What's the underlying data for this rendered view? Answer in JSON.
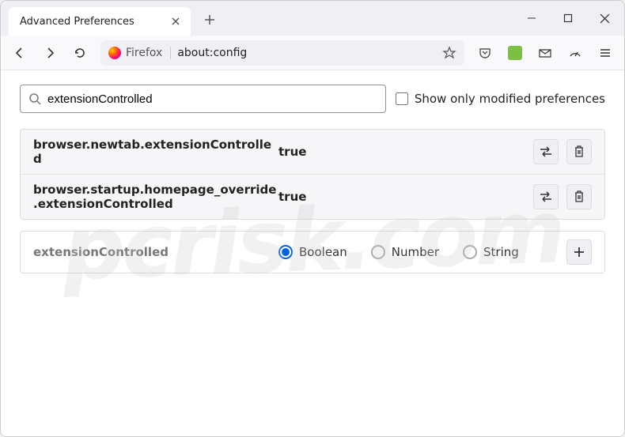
{
  "tab": {
    "title": "Advanced Preferences"
  },
  "urlbar": {
    "identity": "Firefox",
    "url": "about:config"
  },
  "search": {
    "value": "extensionControlled"
  },
  "checkbox": {
    "label": "Show only modified preferences"
  },
  "prefs": [
    {
      "name": "browser.newtab.extensionControlled",
      "value": "true"
    },
    {
      "name": "browser.startup.homepage_override.extensionControlled",
      "value": "true"
    }
  ],
  "newPref": {
    "name": "extensionControlled",
    "types": [
      "Boolean",
      "Number",
      "String"
    ],
    "selected": "Boolean"
  },
  "watermark": "pcrisk.com"
}
